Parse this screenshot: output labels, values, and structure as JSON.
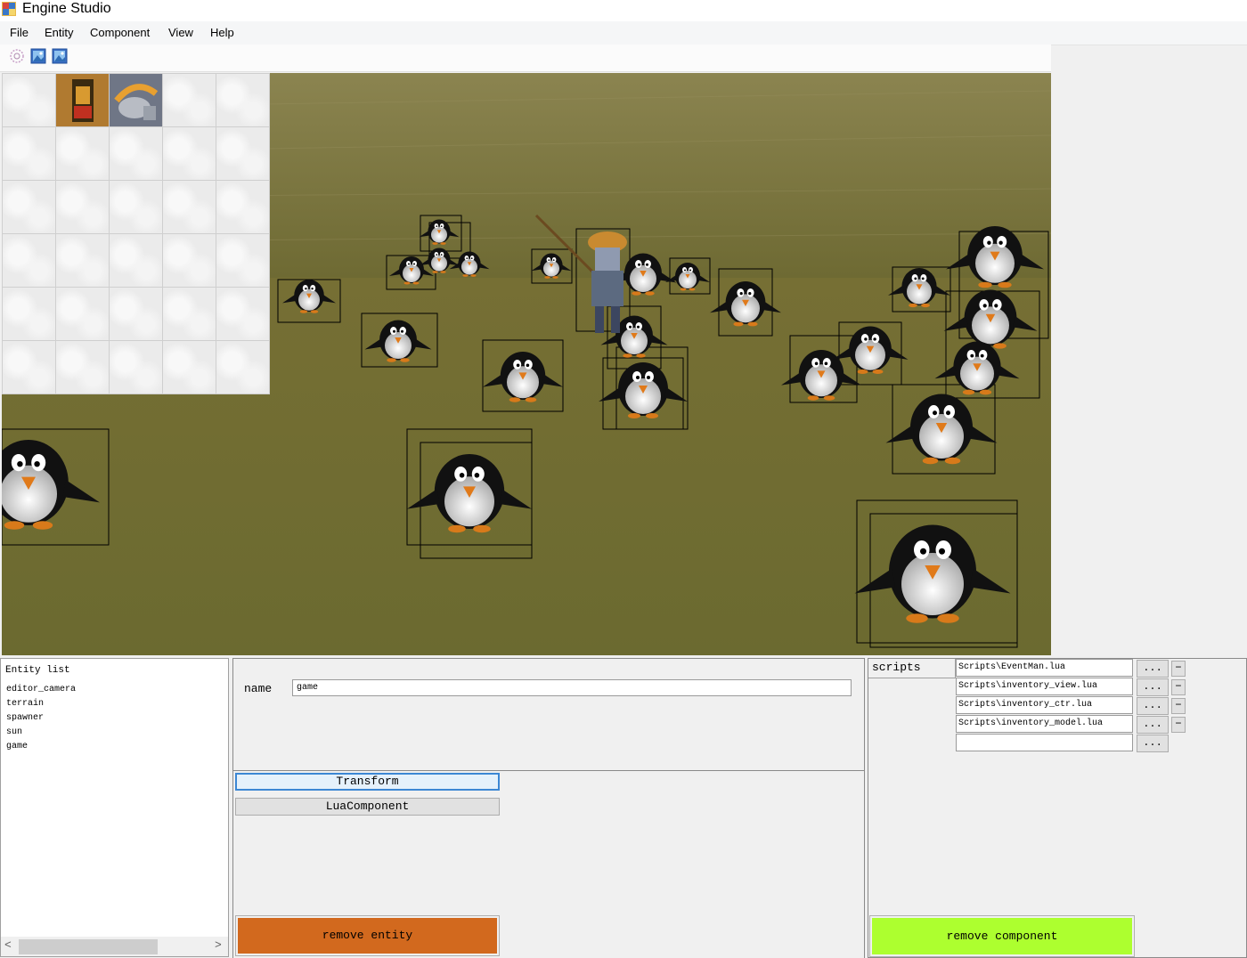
{
  "window": {
    "title": "Engine Studio"
  },
  "menu": [
    "File",
    "Entity",
    "Component",
    "View",
    "Help"
  ],
  "toolbar": {
    "icons": [
      "gear-icon",
      "image-icon",
      "image-icon"
    ]
  },
  "viewport": {
    "scene": "3d-viewport",
    "entities": [
      "penguin",
      "knight"
    ]
  },
  "inventory": {
    "rows": 6,
    "cols": 5,
    "items": [
      "shrine-item-icon",
      "helmet-item-icon"
    ]
  },
  "entity_list": {
    "title": "Entity list",
    "items": [
      "editor_camera",
      "terrain",
      "spawner",
      "sun",
      "game"
    ]
  },
  "properties": {
    "name_label": "name",
    "name_value": "game"
  },
  "components": {
    "transform_label": "Transform",
    "lua_label": "LuaComponent",
    "remove_entity_label": "remove entity"
  },
  "scripts": {
    "label": "scripts",
    "entries": [
      "Scripts\\EventMan.lua",
      "Scripts\\inventory_view.lua",
      "Scripts\\inventory_ctr.lua",
      "Scripts\\inventory_model.lua",
      ""
    ],
    "browse_label": "...",
    "remove_label": "−",
    "remove_component_label": "remove component"
  },
  "colors": {
    "remove_entity": "#d2691e",
    "remove_component": "#adff2f",
    "terrain": "#75712f"
  }
}
